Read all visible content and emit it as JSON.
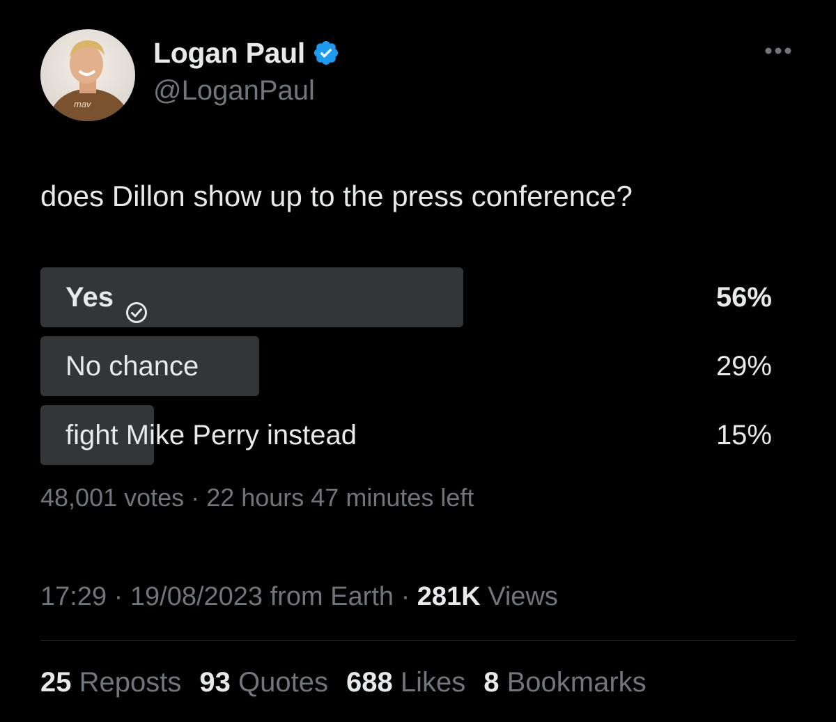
{
  "user": {
    "display_name": "Logan Paul",
    "handle": "@LoganPaul",
    "avatar_shirt_text": "mav"
  },
  "tweet": {
    "text": "does Dillon show up to the press conference?"
  },
  "poll": {
    "options": [
      {
        "label": "Yes",
        "percent": "56%",
        "fraction": 0.56,
        "winner": true
      },
      {
        "label": "No chance",
        "percent": "29%",
        "fraction": 0.29,
        "winner": false
      },
      {
        "label": "fight Mike Perry instead",
        "percent": "15%",
        "fraction": 0.15,
        "winner": false
      }
    ],
    "votes": "48,001 votes",
    "separator": "·",
    "time_left": "22 hours 47 minutes left"
  },
  "meta": {
    "time": "17:29",
    "separator": "·",
    "date": "19/08/2023",
    "source": "from Earth",
    "views_count": "281K",
    "views_label": "Views"
  },
  "stats": {
    "reposts_count": "25",
    "reposts_label": "Reposts",
    "quotes_count": "93",
    "quotes_label": "Quotes",
    "likes_count": "688",
    "likes_label": "Likes",
    "bookmarks_count": "8",
    "bookmarks_label": "Bookmarks"
  },
  "colors": {
    "background": "#000000",
    "text_primary": "#e7e9ea",
    "text_secondary": "#71767b",
    "poll_bar": "#333639",
    "verified_blue": "#1d9bf0",
    "divider": "#2f3336"
  },
  "icons": {
    "verified": "verified-badge-icon",
    "more": "more-options-icon",
    "check": "check-circle-icon"
  }
}
